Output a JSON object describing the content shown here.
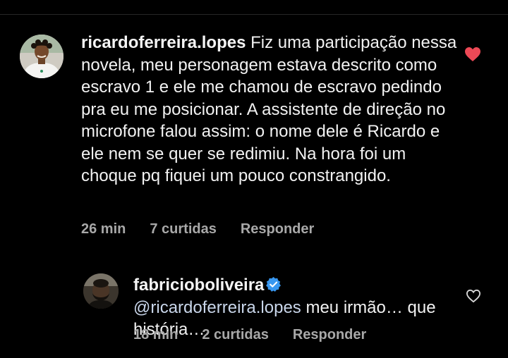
{
  "comment": {
    "username": "ricardoferreira.lopes",
    "text": "Fiz uma participação nessa novela, meu personagem estava descrito como escravo 1 e ele me chamou de escravo pedindo pra eu me posicionar. A assistente de direção no microfone falou assim: o nome dele é Ricardo e ele nem se quer se redimiu. Na hora foi um choque pq fiquei um pouco constrangido.",
    "time": "26 min",
    "likes": "7 curtidas",
    "reply_label": "Responder",
    "liked": true,
    "like_icon": "heart-filled-icon"
  },
  "reply": {
    "username": "fabricioboliveira",
    "verified": true,
    "mention": "@ricardoferreira.lopes",
    "text": "meu irmão… que história….",
    "time": "18 min",
    "likes": "2 curtidas",
    "reply_label": "Responder",
    "liked": false,
    "like_icon": "heart-outline-icon"
  },
  "colors": {
    "background": "#000000",
    "text": "#f2f2f2",
    "meta": "#a8a8a8",
    "heart_active": "#ed4956",
    "verified": "#3897f0",
    "mention": "#c9d6ea"
  }
}
